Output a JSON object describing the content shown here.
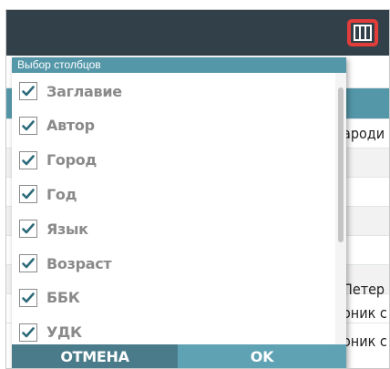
{
  "colors": {
    "topbar": "#324149",
    "highlight_border": "#e23d3a",
    "dialog_header": "#5497a9",
    "cancel_bg": "#4a7b8a",
    "ok_bg": "#5ea2b3",
    "label_text": "#8a8a8a",
    "check": "#2c6a7a"
  },
  "toolbar": {
    "columns_button_icon": "columns-icon"
  },
  "dialog": {
    "title": "Выбор столбцов",
    "options": [
      {
        "label": "Заглавие",
        "checked": true
      },
      {
        "label": "Автор",
        "checked": true
      },
      {
        "label": "Город",
        "checked": true
      },
      {
        "label": "Год",
        "checked": true
      },
      {
        "label": "Язык",
        "checked": true
      },
      {
        "label": "Возраст",
        "checked": true
      },
      {
        "label": "ББК",
        "checked": true
      },
      {
        "label": "УДК",
        "checked": true
      }
    ],
    "cancel_label": "ОТМЕНА",
    "ok_label": "OK"
  },
  "background_table": {
    "cells": [
      "ароди",
      "Петер",
      "оник с",
      "оник с"
    ]
  }
}
